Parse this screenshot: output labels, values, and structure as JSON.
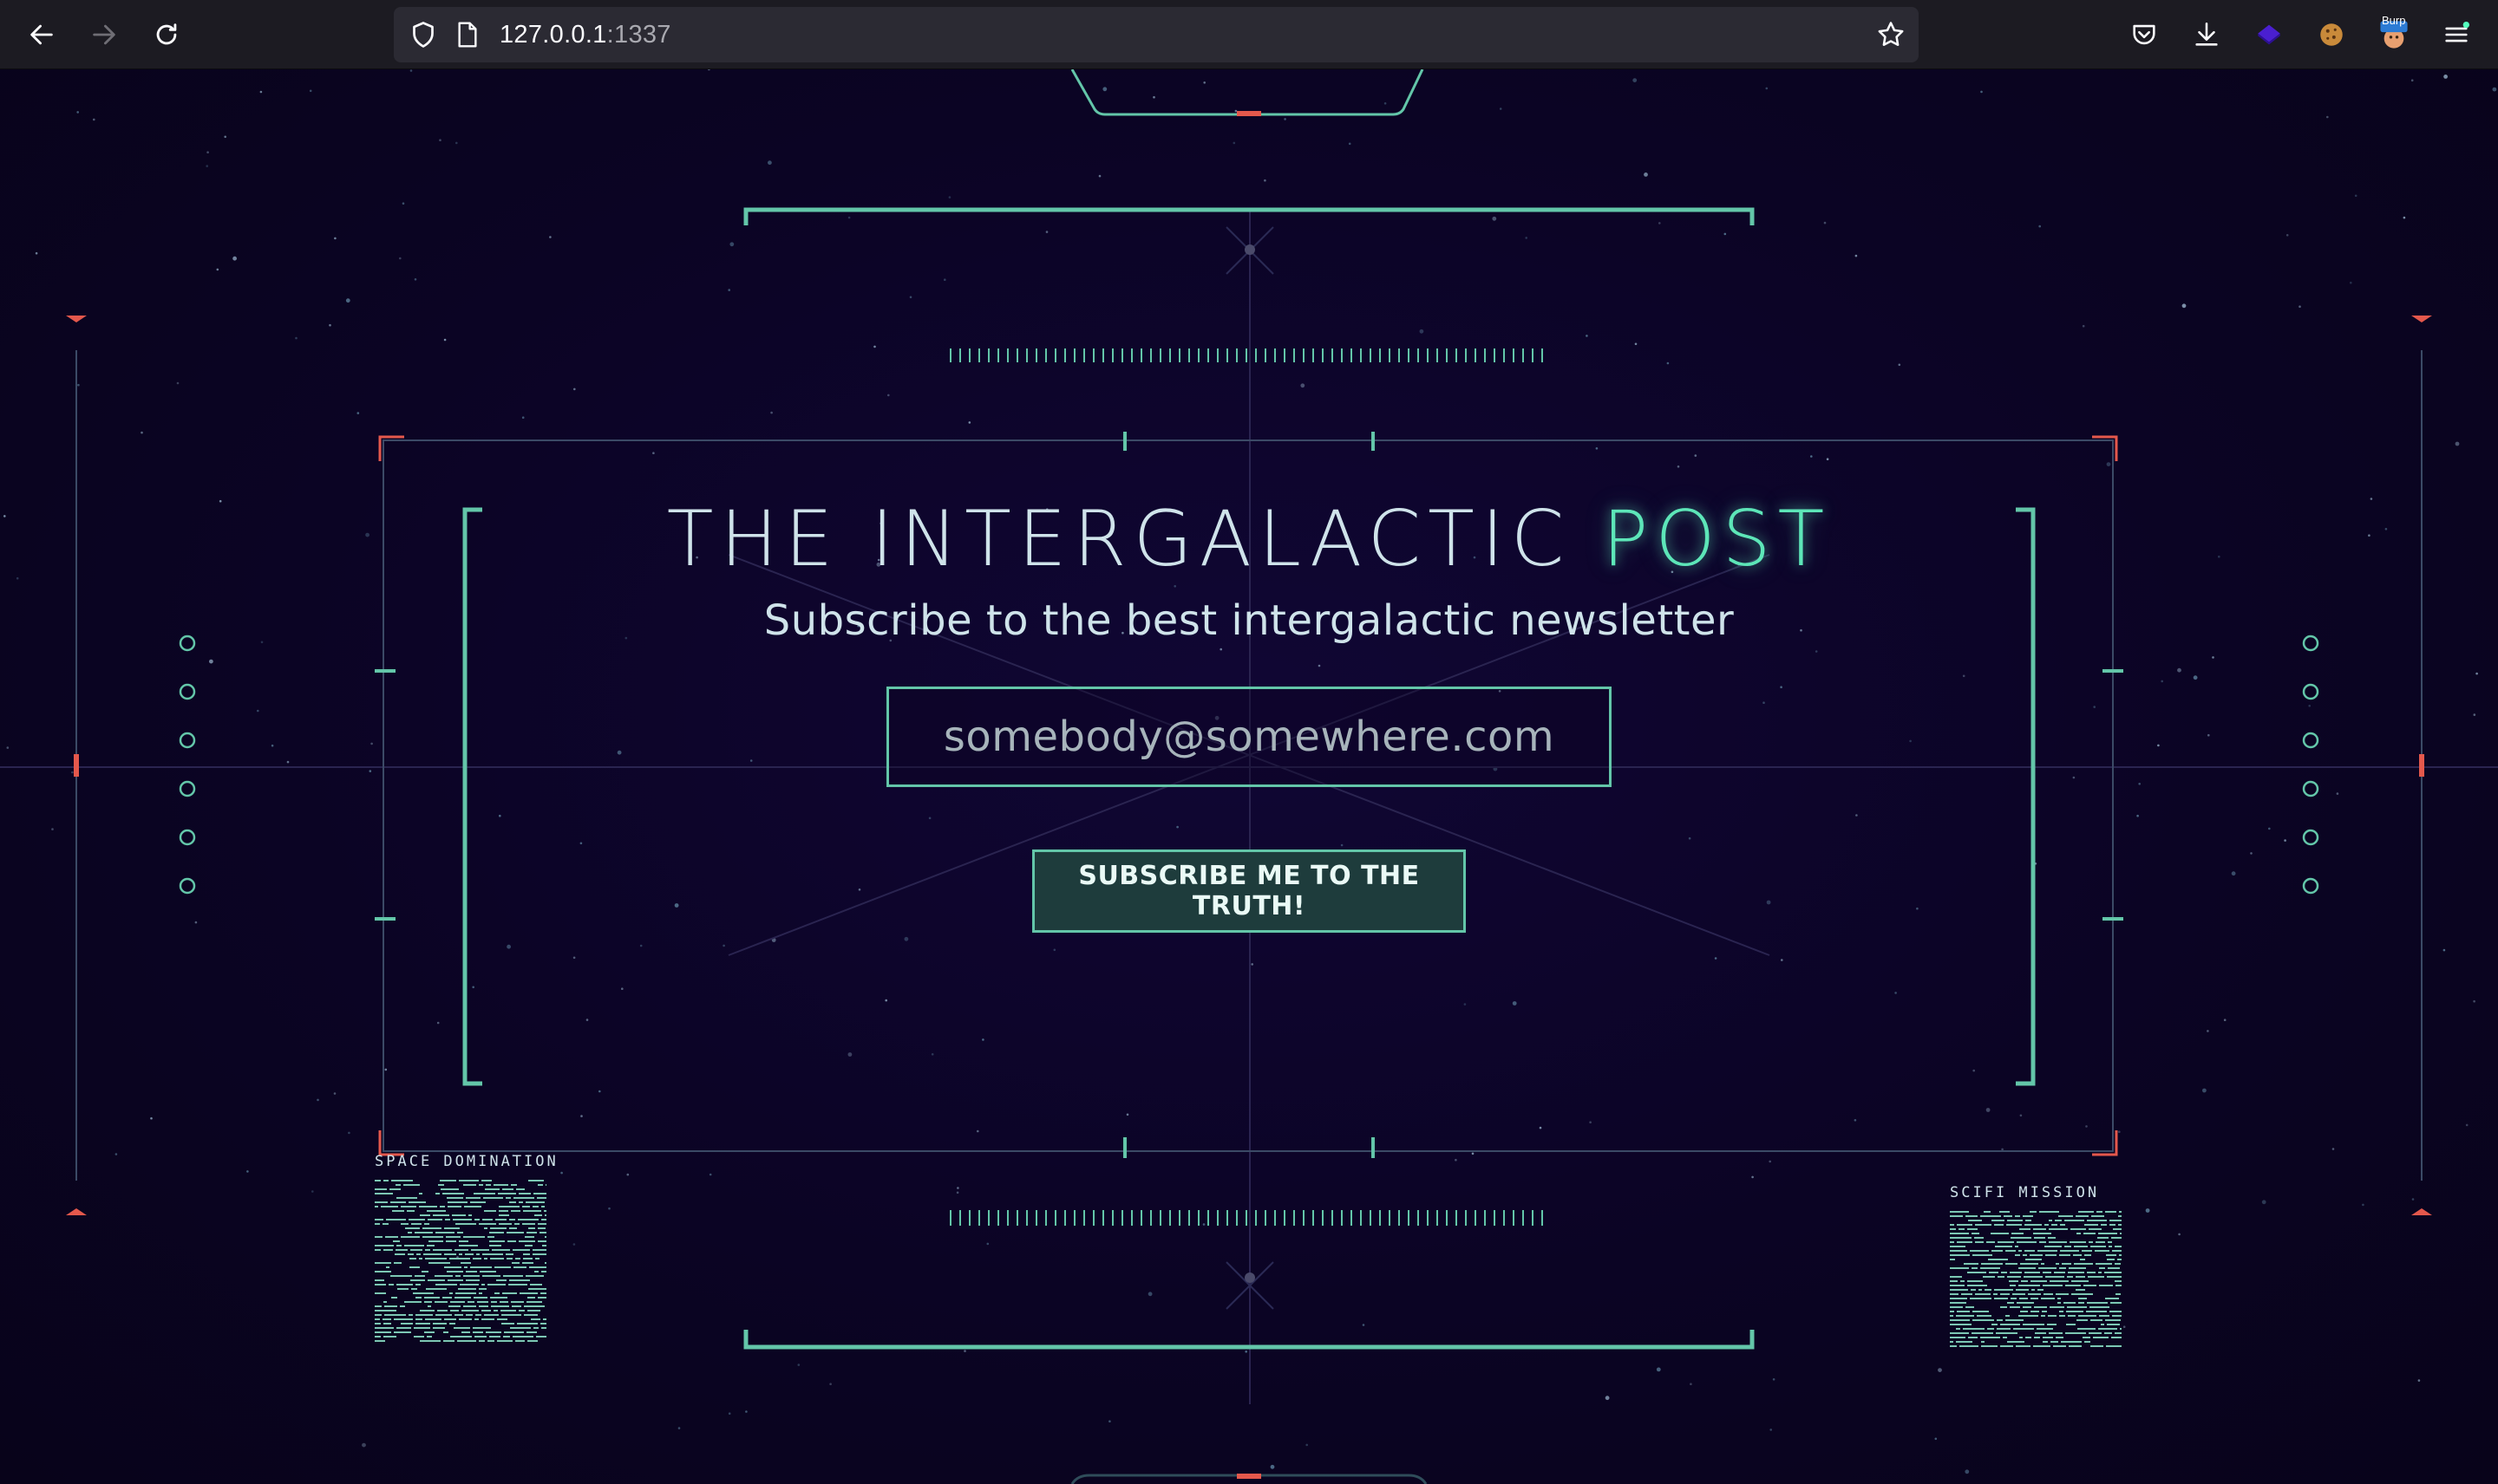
{
  "browser": {
    "url_host": "127.0.0.1",
    "url_port": ":1337",
    "toolbar_icons": [
      "back-icon",
      "forward-icon",
      "reload-icon",
      "shield-icon",
      "page-icon",
      "bookmark-star-icon",
      "pocket-icon",
      "download-icon",
      "extension-icon",
      "cookie-icon",
      "burp-extension-icon",
      "menu-icon"
    ],
    "burp_badge": "Burp"
  },
  "hero": {
    "title_main": "THE INTERGALACTIC",
    "title_accent": "POST",
    "subtitle": "Subscribe to the best intergalactic newsletter"
  },
  "form": {
    "email_placeholder": "somebody@somewhere.com",
    "submit_label": "SUBSCRIBE ME TO THE TRUTH!"
  },
  "panels": {
    "left_label": "SPACE DOMINATION",
    "right_label": "SCIFI MISSION"
  },
  "colors": {
    "background": "#0b0420",
    "accent_teal": "#63c6a9",
    "accent_green": "#5de6b8",
    "alert_red": "#e4584c",
    "text": "#cfe3ea"
  }
}
